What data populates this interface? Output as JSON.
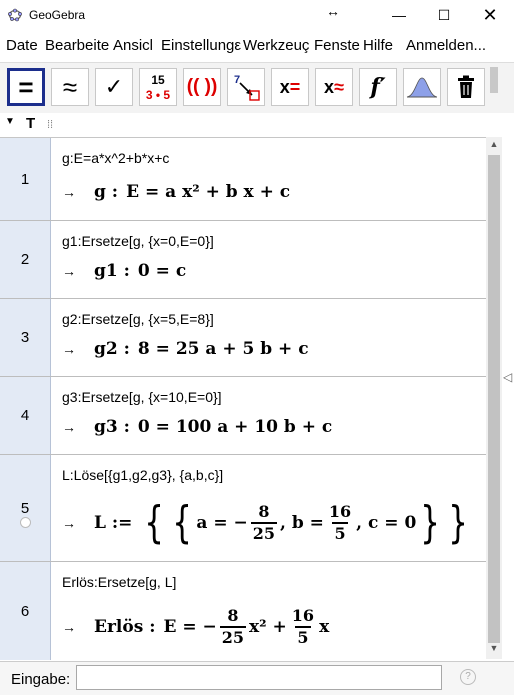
{
  "window": {
    "title": "GeoGebra",
    "resize_glyph": "↔",
    "minimize": "—",
    "maximize": "☐",
    "close": "✕"
  },
  "menu": [
    "Date",
    "Bearbeite",
    "Ansicl",
    "Einstellungε",
    "Werkzeuç",
    "Fenste",
    "Hilfe",
    "Anmelden..."
  ],
  "toolbar": {
    "tools": [
      {
        "name": "evaluate-tool",
        "glyph": "=",
        "active": true
      },
      {
        "name": "numeric-tool",
        "glyph": "≈"
      },
      {
        "name": "keep-input-tool",
        "glyph": "✓"
      },
      {
        "name": "factor-numbers-tool",
        "glyph": "15 / 3·5"
      },
      {
        "name": "expand-tool",
        "glyph": "(( ))"
      },
      {
        "name": "substitute-tool",
        "glyph": "7↘"
      },
      {
        "name": "solve-tool",
        "glyph": "x ="
      },
      {
        "name": "solve-numerically-tool",
        "glyph": "x ≈"
      },
      {
        "name": "derivative-tool",
        "glyph": "f′"
      },
      {
        "name": "probability-tool",
        "glyph": "bell"
      },
      {
        "name": "delete-tool",
        "glyph": "trash"
      }
    ]
  },
  "stylebar": {
    "text_tool": "T"
  },
  "cas": {
    "rows": [
      {
        "number": "1",
        "input": "g:E=a*x^2+b*x+c",
        "output_label": "g :",
        "output": "E = a x² + b x + c"
      },
      {
        "number": "2",
        "input": "g1:Ersetze[g, {x=0,E=0}]",
        "output_label": "g1 :",
        "output": "0 = c"
      },
      {
        "number": "3",
        "input": "g2:Ersetze[g, {x=5,E=8}]",
        "output_label": "g2 :",
        "output": "8 = 25 a + 5 b + c"
      },
      {
        "number": "4",
        "input": "g3:Ersetze[g, {x=10,E=0}]",
        "output_label": "g3 :",
        "output": "0 = 100 a + 10 b + c"
      },
      {
        "number": "5",
        "input": "L:Löse[{g1,g2,g3}, {a,b,c}]",
        "output_label": "L :=",
        "output_parts": {
          "a_lhs": "a = −",
          "a_num": "8",
          "a_den": "25",
          "b_lhs": ", b =",
          "b_num": "16",
          "b_den": "5",
          "c_part": ", c = 0"
        }
      },
      {
        "number": "6",
        "input": "Erlös:Ersetze[g, L]",
        "output_label": "Erlös :",
        "output_parts": {
          "lhs": "E = −",
          "t1_num": "8",
          "t1_den": "25",
          "t1_var": "x² +",
          "t2_num": "16",
          "t2_den": "5",
          "t2_var": "x"
        }
      }
    ],
    "arrow": "→"
  },
  "input_bar": {
    "label": "Eingabe:",
    "value": "",
    "help": "?"
  }
}
